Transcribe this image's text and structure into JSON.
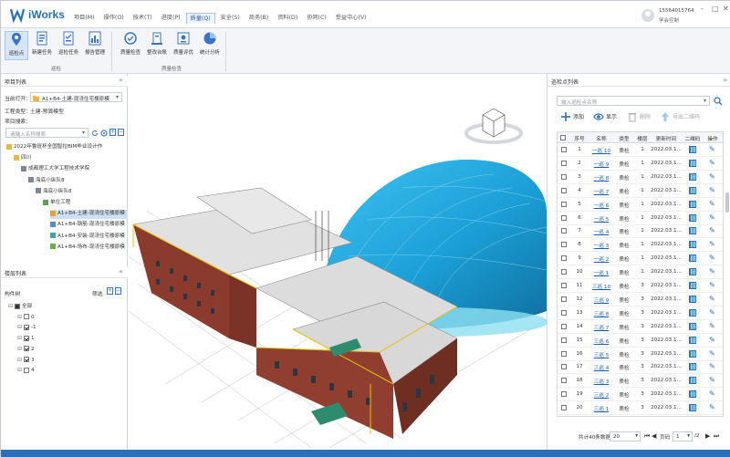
{
  "app": {
    "name": "iWorks"
  },
  "menus": [
    "项目(M)",
    "操作(O)",
    "技术(T)",
    "进度(P)",
    "质量(Q)",
    "安全(S)",
    "商务(B)",
    "资料(D)",
    "协同(C)",
    "受益中心(V)"
  ],
  "active_menu_index": 4,
  "user": {
    "name": "15564015764",
    "role": "学会控制"
  },
  "window_controls": [
    "-",
    "□",
    "✕"
  ],
  "ribbon": {
    "groups": [
      {
        "label": "巡检",
        "buttons": [
          {
            "label": "巡检点",
            "icon": "location-pin-icon",
            "selected": true
          },
          {
            "label": "新建任务",
            "icon": "new-task-icon"
          },
          {
            "label": "巡检任务",
            "icon": "task-list-icon"
          },
          {
            "label": "报告管理",
            "icon": "report-icon"
          }
        ]
      },
      {
        "label": "质量检查",
        "buttons": [
          {
            "label": "质量检查",
            "icon": "quality-check-icon"
          },
          {
            "label": "整改台账",
            "icon": "ledger-icon"
          },
          {
            "label": "质量评优",
            "icon": "rating-icon"
          },
          {
            "label": "统计分析",
            "icon": "stats-icon"
          }
        ]
      }
    ]
  },
  "left": {
    "project_list_title": "项目列表",
    "currently_open_label": "当前打开：",
    "currently_open_value": "A1+B4-土建-现浇住宅楼原模",
    "engineering_type_label": "工程类型：",
    "engineering_type_value": "土建-预算模型",
    "project_search_label": "项目搜索：",
    "search_placeholder": "请输入名称搜索",
    "tree": [
      {
        "label": "2022年鲁班杯全国智拉BIM毕业设计作",
        "level": 0,
        "icon": "folder"
      },
      {
        "label": "四川",
        "level": 1,
        "icon": "folder"
      },
      {
        "label": "成都理工大学工程技术学院",
        "level": 2,
        "icon": "building"
      },
      {
        "label": "海底小纵队8",
        "level": 3,
        "icon": "building"
      },
      {
        "label": "海底小纵队8",
        "level": 4,
        "icon": "building"
      },
      {
        "label": "单位工程",
        "level": 5,
        "icon": "unit"
      },
      {
        "label": "A1+B4-土建-现浇住宅楼原模",
        "level": 6,
        "icon": "model-civil",
        "highlight": true
      },
      {
        "label": "A1+B4-钢筋-现浇住宅楼原模",
        "level": 6,
        "icon": "model-steel"
      },
      {
        "label": "A1+B4-安装-现浇住宅楼原模",
        "level": 6,
        "icon": "model-install"
      },
      {
        "label": "A1+B4-场布-现浇住宅楼原模",
        "level": 6,
        "icon": "model-site"
      }
    ],
    "floor_list_title": "楼层列表",
    "floor_tool_label": "构件树",
    "floor_filter_label": "筛选",
    "floors": [
      {
        "label": "全部",
        "level": 0,
        "checked": "full"
      },
      {
        "label": "0",
        "level": 1,
        "checked": "off"
      },
      {
        "label": "-1",
        "level": 1,
        "checked": "on"
      },
      {
        "label": "1",
        "level": 1,
        "checked": "on"
      },
      {
        "label": "2",
        "level": 1,
        "checked": "on"
      },
      {
        "label": "3",
        "level": 1,
        "checked": "on"
      },
      {
        "label": "4",
        "level": 1,
        "checked": "off"
      }
    ]
  },
  "right": {
    "title": "巡检点列表",
    "search_placeholder": "输入巡检点名称",
    "tools": {
      "add": "添加",
      "show": "显示",
      "delete": "删除",
      "export": "导出二维码"
    },
    "columns": [
      "",
      "序号",
      "名称",
      "类型",
      "楼层",
      "更新时间",
      "二维码",
      "操作"
    ],
    "rows": [
      {
        "n": "1",
        "name": "一巡 10",
        "type": "质检",
        "floor": "1",
        "time": "2022.03.1..."
      },
      {
        "n": "2",
        "name": "一巡 9",
        "type": "质检",
        "floor": "1",
        "time": "2022.03.1..."
      },
      {
        "n": "3",
        "name": "一巡 8",
        "type": "质检",
        "floor": "1",
        "time": "2022.03.1..."
      },
      {
        "n": "4",
        "name": "一巡 7",
        "type": "质检",
        "floor": "1",
        "time": "2022.03.1..."
      },
      {
        "n": "5",
        "name": "一巡 6",
        "type": "质检",
        "floor": "1",
        "time": "2022.03.1..."
      },
      {
        "n": "6",
        "name": "一巡 5",
        "type": "质检",
        "floor": "1",
        "time": "2022.03.1..."
      },
      {
        "n": "7",
        "name": "一巡 4",
        "type": "质检",
        "floor": "1",
        "time": "2022.03.1..."
      },
      {
        "n": "8",
        "name": "一巡 3",
        "type": "质检",
        "floor": "1",
        "time": "2022.03.1..."
      },
      {
        "n": "9",
        "name": "一巡 2",
        "type": "质检",
        "floor": "1",
        "time": "2022.03.1..."
      },
      {
        "n": "10",
        "name": "一巡 1",
        "type": "质检",
        "floor": "1",
        "time": "2022.03.1..."
      },
      {
        "n": "11",
        "name": "三巡 10",
        "type": "质检",
        "floor": "3",
        "time": "2022.03.1..."
      },
      {
        "n": "12",
        "name": "三巡 9",
        "type": "质检",
        "floor": "3",
        "time": "2022.03.1..."
      },
      {
        "n": "13",
        "name": "三巡 8",
        "type": "质检",
        "floor": "3",
        "time": "2022.03.1..."
      },
      {
        "n": "14",
        "name": "三巡 7",
        "type": "质检",
        "floor": "3",
        "time": "2022.03.1..."
      },
      {
        "n": "15",
        "name": "三巡 6",
        "type": "质检",
        "floor": "3",
        "time": "2022.03.1..."
      },
      {
        "n": "16",
        "name": "三巡 5",
        "type": "质检",
        "floor": "3",
        "time": "2022.03.1..."
      },
      {
        "n": "17",
        "name": "三巡 4",
        "type": "质检",
        "floor": "3",
        "time": "2022.03.1..."
      },
      {
        "n": "18",
        "name": "三巡 3",
        "type": "质检",
        "floor": "3",
        "time": "2022.03.1..."
      },
      {
        "n": "19",
        "name": "三巡 2",
        "type": "质检",
        "floor": "3",
        "time": "2022.03.1..."
      },
      {
        "n": "20",
        "name": "三巡 1",
        "type": "质检",
        "floor": "3",
        "time": "2022.03.1..."
      }
    ],
    "pager": {
      "total": "共计40条数据",
      "page_size": "20",
      "page_label": "页码",
      "page": "1",
      "total_pages": "/2"
    }
  },
  "colors": {
    "accent": "#2b6fb8",
    "dome": "#1ea7dd",
    "wall": "#8a3b2e",
    "roof": "#dcdcdc",
    "highlight": "#e8c400"
  }
}
